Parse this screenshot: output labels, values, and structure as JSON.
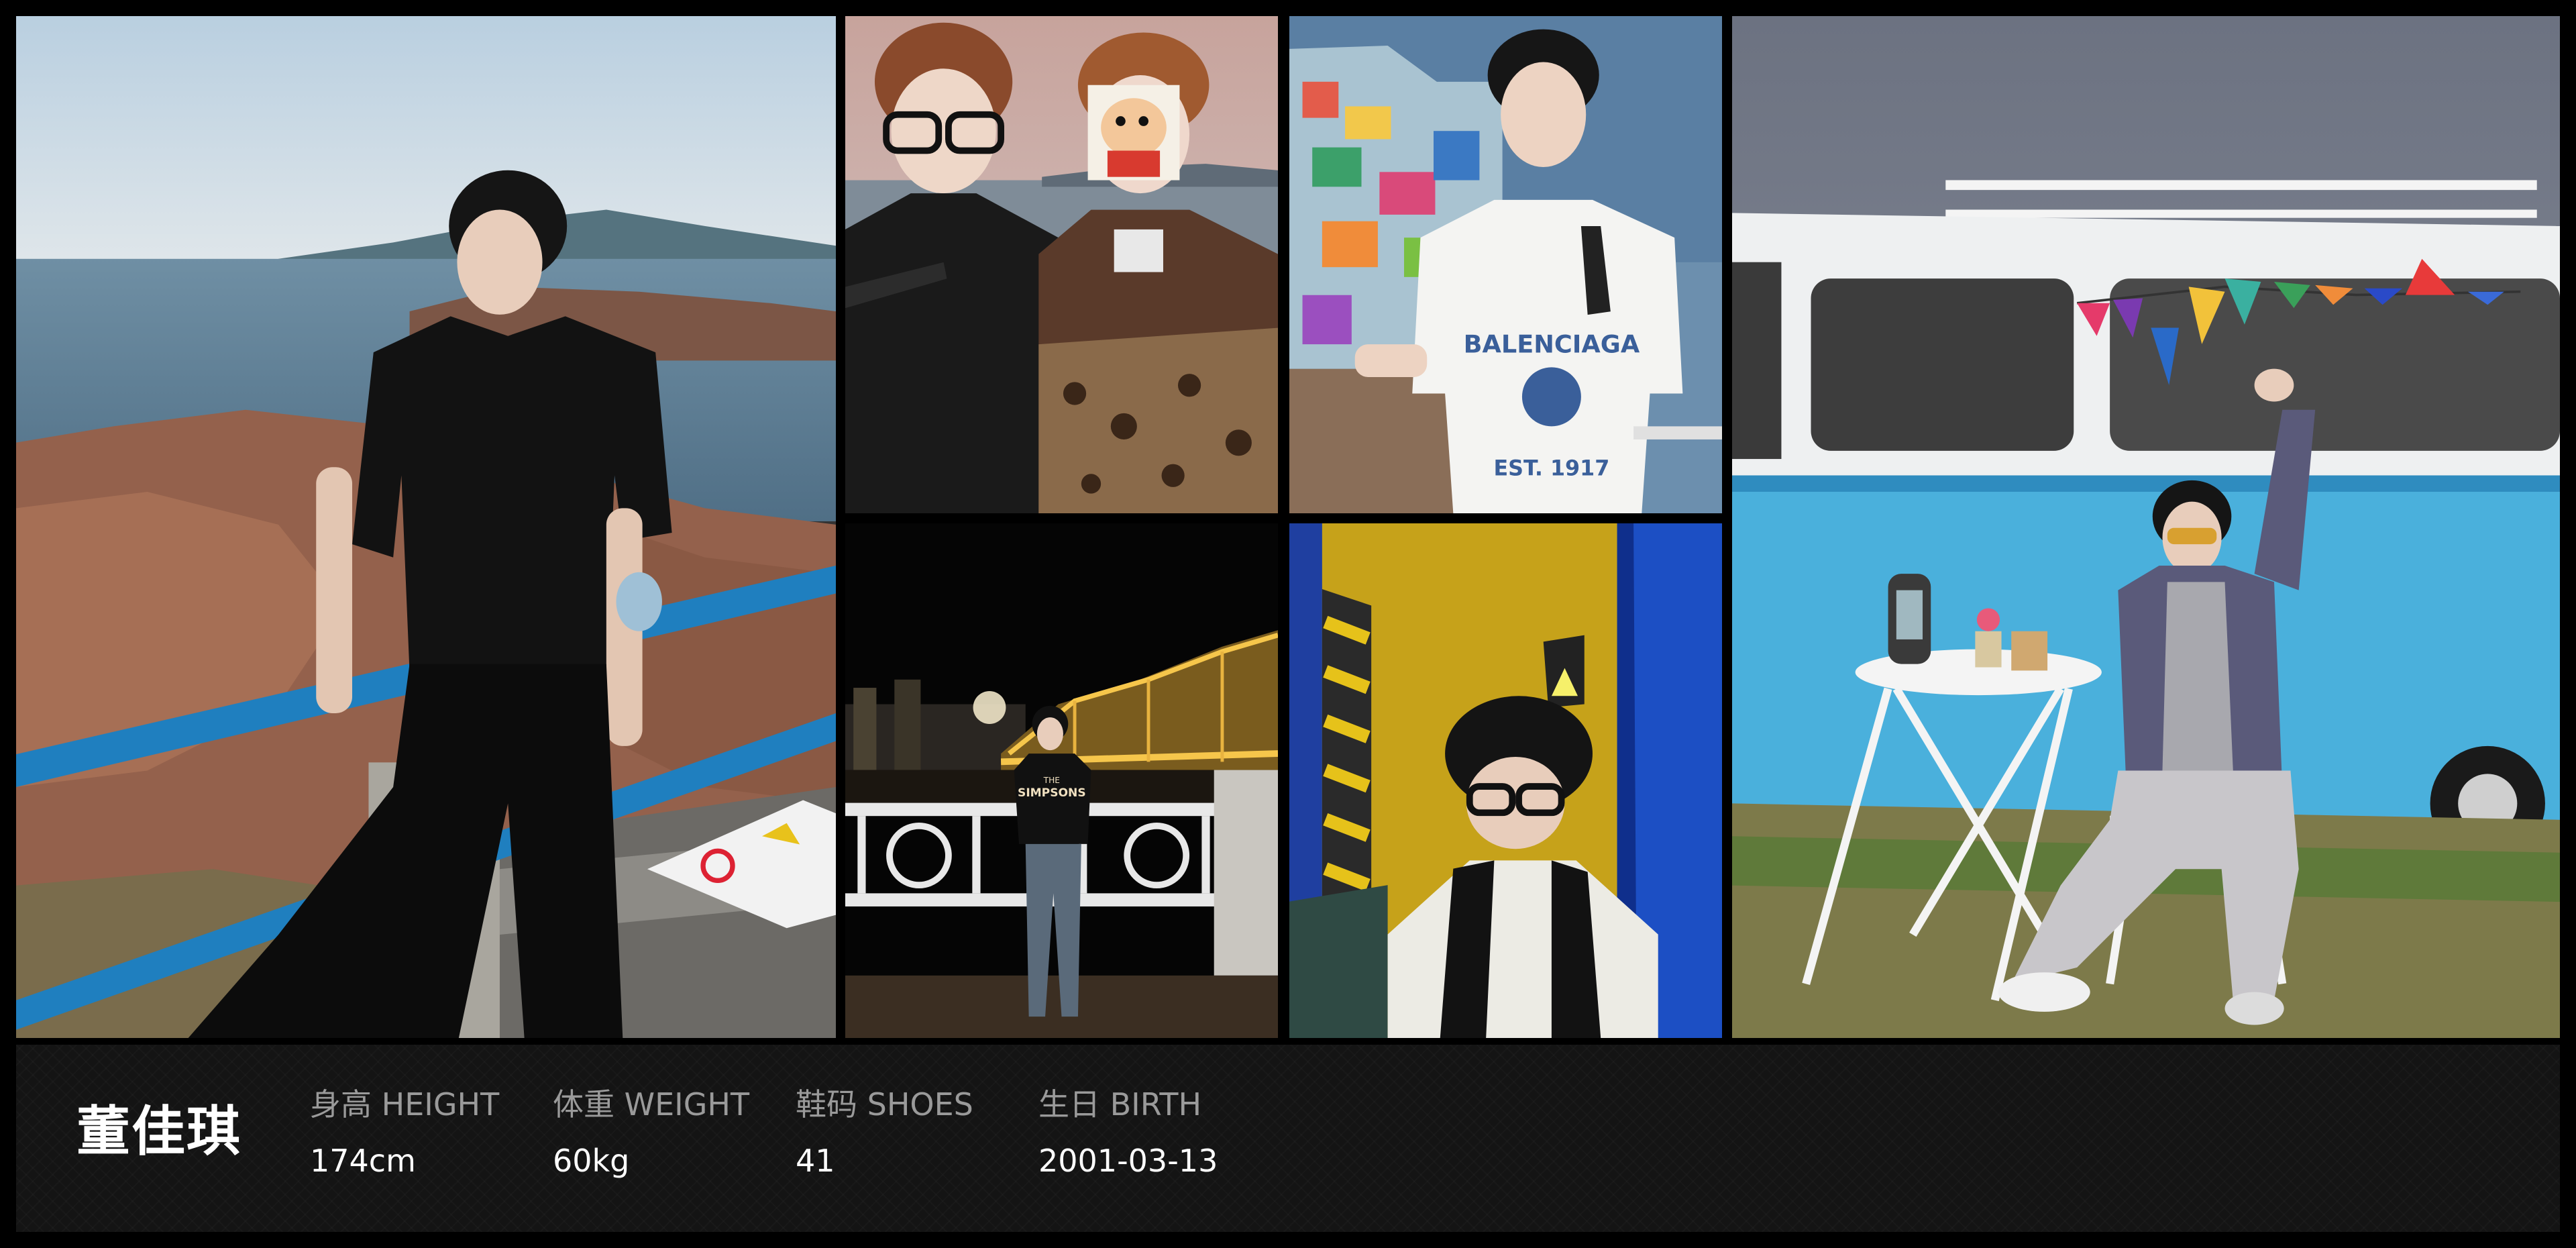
{
  "profile": {
    "name": "董佳琪",
    "stats": {
      "height": {
        "label": "身高 HEIGHT",
        "value": "174cm"
      },
      "weight": {
        "label": "体重 WEIGHT",
        "value": "60kg"
      },
      "shoes": {
        "label": "鞋码 SHOES",
        "value": "41"
      },
      "birth": {
        "label": "生日 BIRTH",
        "value": "2001-03-13"
      }
    }
  },
  "photos": {
    "seaside_standing": {
      "subject": "man-in-black-outfit-at-seaside-rocks"
    },
    "two_friends": {
      "subject": "two-young-men-selfie-one-face-covered-by-sticker"
    },
    "balenciaga_tee": {
      "subject": "young-man-in-white-tee-by-mosaic-wall",
      "shirt_lines": [
        "BALENCIAGA",
        "EST. 1917"
      ]
    },
    "night_bridge": {
      "subject": "man-standing-at-night-bridge-railing",
      "shirt_lines": [
        "THE",
        "SIMPSONS"
      ]
    },
    "yellow_wall": {
      "subject": "man-with-glasses-and-scarf-against-yellow-wall"
    },
    "blue_bus": {
      "subject": "man-seated-by-blue-bus-with-bunting-and-table"
    }
  },
  "colors": {
    "background": "#000000",
    "info_bar": "#141414",
    "label": "#9a9a9a",
    "value": "#ffffff"
  }
}
